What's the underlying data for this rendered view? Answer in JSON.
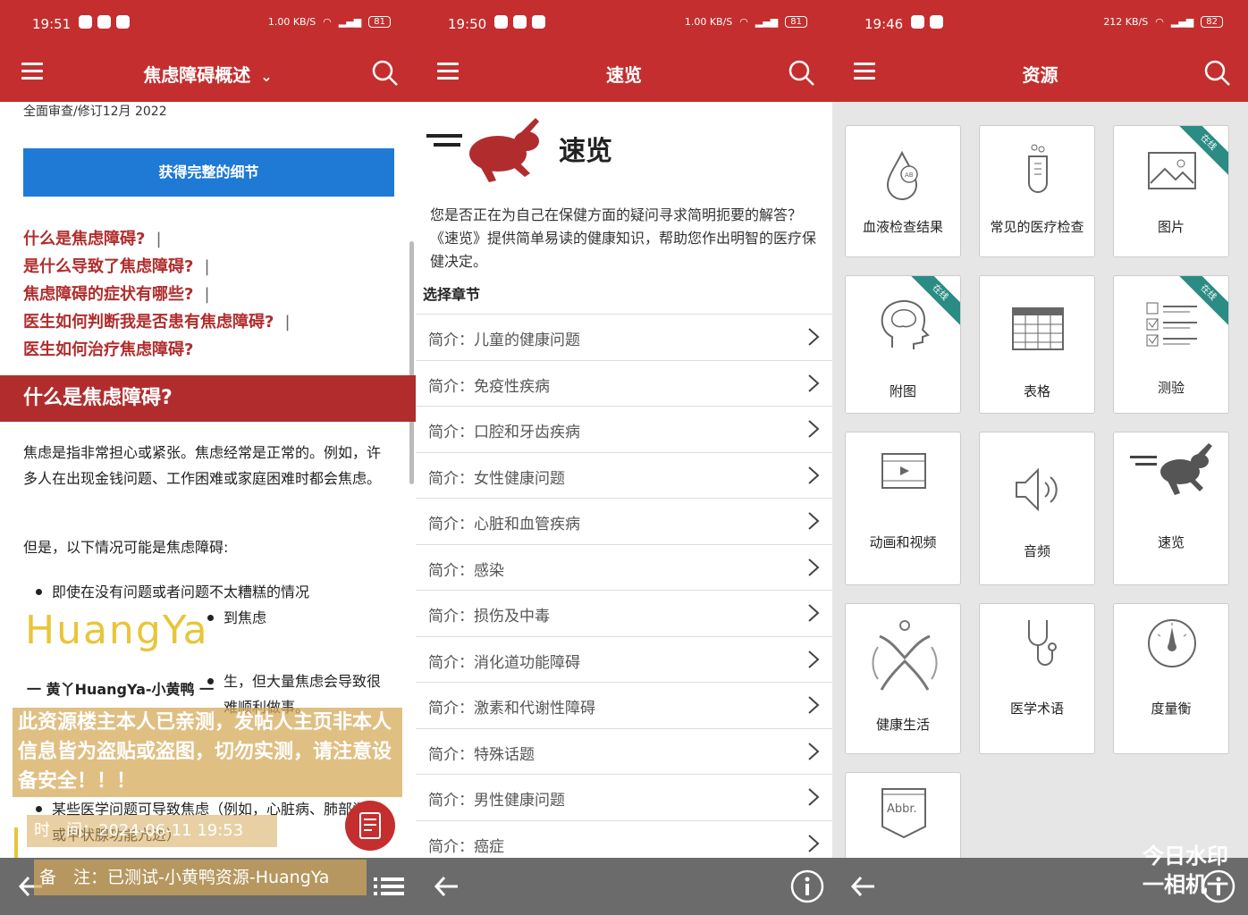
{
  "panel1": {
    "status": {
      "time": "19:51",
      "net": "1.00 KB/S",
      "battery": "81"
    },
    "title": "焦虑障碍概述",
    "revised": "全面审查/修订12月 2022",
    "cta": "获得完整的细节",
    "toc": [
      "什么是焦虑障碍?",
      "是什么导致了焦虑障碍?",
      "焦虑障碍的症状有哪些?",
      "医生如何判断我是否患有焦虑障碍?",
      "医生如何治疗焦虑障碍?"
    ],
    "section_heading": "什么是焦虑障碍?",
    "para1": "焦虑是指非常担心或紧张。焦虑经常是正常的。例如，许多人在出现金钱问题、工作困难或家庭困难时都会焦虑。",
    "para2": "但是，以下情况可能是焦虑障碍:",
    "bullet1": "即使在没有问题或者问题不太糟糕的情况",
    "bullet1b": "到焦虑",
    "bullet2": "生，但大量焦虑会导致很难顺利做事。",
    "bullet3": "某些医学问题可导致焦虑（例如，心脏病、肺部问题或甲状腺功能亢进）",
    "watermark_logo": "HuangYa",
    "watermark_sub": "一 黄丫HuangYa-小黄鸭 一",
    "overlay_note": "此资源楼主本人已亲测，发帖人主页非本人信息皆为盗贴或盗图，切勿实测，请注意设备安全！！！",
    "stamp_time": "时　间：2024-06-11 19:53",
    "stamp_note": "备　注：已测试-小黄鸭资源-HuangYa"
  },
  "panel2": {
    "status": {
      "time": "19:50",
      "net": "1.00 KB/S",
      "battery": "81"
    },
    "title": "速览",
    "heading": "速览",
    "desc": "您是否正在为自己在保健方面的疑问寻求简明扼要的解答？《速览》提供简单易读的健康知识，帮助您作出明智的医疗保健决定。",
    "section_label": "选择章节",
    "items": [
      "简介：儿童的健康问题",
      "简介：免疫性疾病",
      "简介：口腔和牙齿疾病",
      "简介：女性健康问题",
      "简介：心脏和血管疾病",
      "简介：感染",
      "简介：损伤及中毒",
      "简介：消化道功能障碍",
      "简介：激素和代谢性障碍",
      "简介：特殊话题",
      "简介：男性健康问题",
      "简介：癌症"
    ]
  },
  "panel3": {
    "status": {
      "time": "19:46",
      "net": "212 KB/S",
      "battery": "82"
    },
    "title": "资源",
    "ribbon": "在线",
    "tiles": [
      {
        "label": "血液检查结果",
        "icon": "blood-drop-icon"
      },
      {
        "label": "常见的医疗检查",
        "icon": "test-tube-icon"
      },
      {
        "label": "图片",
        "icon": "image-icon"
      },
      {
        "label": "附图",
        "icon": "head-brain-icon"
      },
      {
        "label": "表格",
        "icon": "table-icon"
      },
      {
        "label": "测验",
        "icon": "checklist-icon"
      },
      {
        "label": "动画和视频",
        "icon": "film-icon"
      },
      {
        "label": "音频",
        "icon": "speaker-icon"
      },
      {
        "label": "速览",
        "icon": "rabbit-icon"
      },
      {
        "label": "健康生活",
        "icon": "person-icon"
      },
      {
        "label": "医学术语",
        "icon": "stethoscope-icon"
      },
      {
        "label": "度量衡",
        "icon": "gauge-icon"
      },
      {
        "label": "Abbr.",
        "icon": "abbr-icon"
      }
    ],
    "corner_wm1": "今日水印",
    "corner_wm2": "一相机一"
  },
  "colors": {
    "brand": "#c42e2e",
    "link": "#b12d2d",
    "cta": "#1f7ad6",
    "ribbon": "#2b8c84"
  }
}
